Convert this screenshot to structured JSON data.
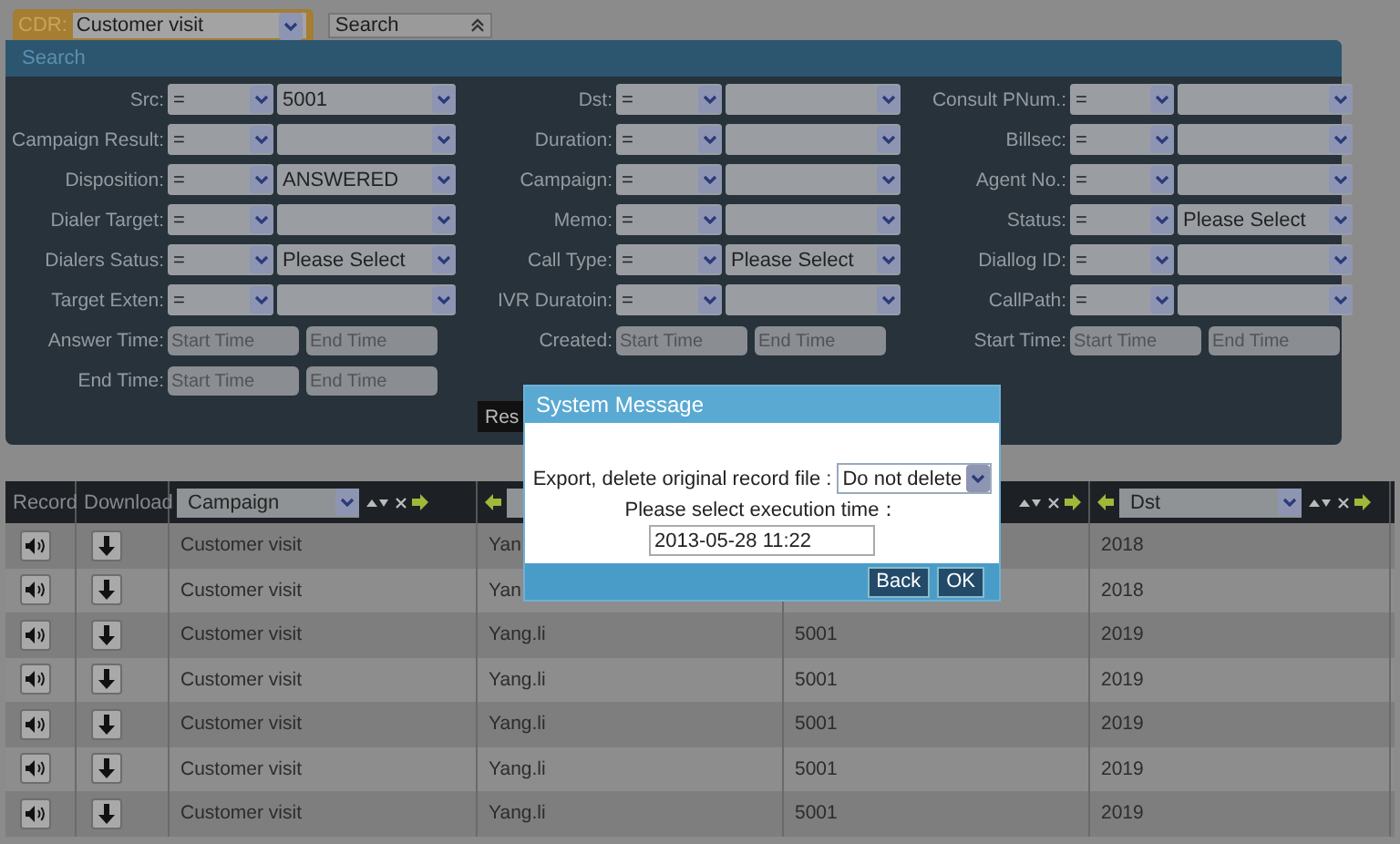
{
  "top_bar": {
    "module_label": "CDR:",
    "module_select": "Customer visit",
    "search_toggle": "Search"
  },
  "search_panel": {
    "title": "Search",
    "rows": [
      [
        {
          "kind": "select",
          "label": "Src:",
          "operator": "=",
          "value": "5001"
        },
        {
          "kind": "select",
          "label": "Dst:",
          "operator": "="
        },
        {
          "kind": "select",
          "label": "Consult PNum.:",
          "operator": "="
        }
      ],
      [
        {
          "kind": "select",
          "label": "Campaign Result:",
          "operator": "="
        },
        {
          "kind": "select",
          "label": "Duration:",
          "operator": "="
        },
        {
          "kind": "select",
          "label": "Billsec:",
          "operator": "="
        }
      ],
      [
        {
          "kind": "select",
          "label": "Disposition:",
          "operator": "=",
          "value": "ANSWERED"
        },
        {
          "kind": "select",
          "label": "Campaign:",
          "operator": "="
        },
        {
          "kind": "select",
          "label": "Agent No.:",
          "operator": "="
        }
      ],
      [
        {
          "kind": "select",
          "label": "Dialer Target:",
          "operator": "="
        },
        {
          "kind": "select",
          "label": "Memo:",
          "operator": "="
        },
        {
          "kind": "select",
          "label": "Status:",
          "operator": "=",
          "value": "Please Select"
        }
      ],
      [
        {
          "kind": "select",
          "label": "Dialers Satus:",
          "operator": "=",
          "value": "Please Select"
        },
        {
          "kind": "select",
          "label": "Call Type:",
          "operator": "=",
          "value": "Please Select"
        },
        {
          "kind": "select",
          "label": "Diallog ID:",
          "operator": "="
        }
      ],
      [
        {
          "kind": "select",
          "label": "Target Exten:",
          "operator": "="
        },
        {
          "kind": "select",
          "label": "IVR Duratoin:",
          "operator": "="
        },
        {
          "kind": "select",
          "label": "CallPath:",
          "operator": "="
        }
      ],
      [
        {
          "kind": "time",
          "label": "Answer Time:",
          "start_placeholder": "Start Time",
          "end_placeholder": "End Time"
        },
        {
          "kind": "time",
          "label": "Created:",
          "start_placeholder": "Start Time",
          "end_placeholder": "End Time"
        },
        {
          "kind": "time",
          "label": "Start Time:",
          "start_placeholder": "Start Time",
          "end_placeholder": "End Time"
        }
      ],
      [
        {
          "kind": "time",
          "label": "End Time:",
          "start_placeholder": "Start Time",
          "end_placeholder": "End Time"
        }
      ]
    ],
    "button": "Res"
  },
  "table": {
    "columns": [
      {
        "kind": "text",
        "label": "Record"
      },
      {
        "kind": "text",
        "label": "Download"
      },
      {
        "kind": "select",
        "value": "Campaign",
        "left_arrow": false,
        "controls": true
      },
      {
        "kind": "select",
        "left_arrow": true,
        "controls": false
      },
      {
        "kind": "controls_only",
        "controls": true
      },
      {
        "kind": "select",
        "value": "Dst",
        "left_arrow": true,
        "controls": true
      }
    ],
    "rows": [
      {
        "campaign": "Customer visit",
        "column_4": "Yan",
        "dst": "2018"
      },
      {
        "campaign": "Customer visit",
        "column_4": "Yan",
        "dst": "2018"
      },
      {
        "campaign": "Customer visit",
        "column_4": "Yang.li",
        "column_5": "5001",
        "dst": "2019"
      },
      {
        "campaign": "Customer visit",
        "column_4": "Yang.li",
        "column_5": "5001",
        "dst": "2019"
      },
      {
        "campaign": "Customer visit",
        "column_4": "Yang.li",
        "column_5": "5001",
        "dst": "2019"
      },
      {
        "campaign": "Customer visit",
        "column_4": "Yang.li",
        "column_5": "5001",
        "dst": "2019"
      },
      {
        "campaign": "Customer visit",
        "column_4": "Yang.li",
        "column_5": "5001",
        "dst": "2019"
      }
    ]
  },
  "dialog": {
    "title": "System Message",
    "delete_label": "Export, delete original record file :",
    "delete_select": "Do not delete",
    "time_label": "Please select execution time：",
    "time_value": "2013-05-28 11:22",
    "buttons": [
      "Back",
      "OK"
    ]
  }
}
